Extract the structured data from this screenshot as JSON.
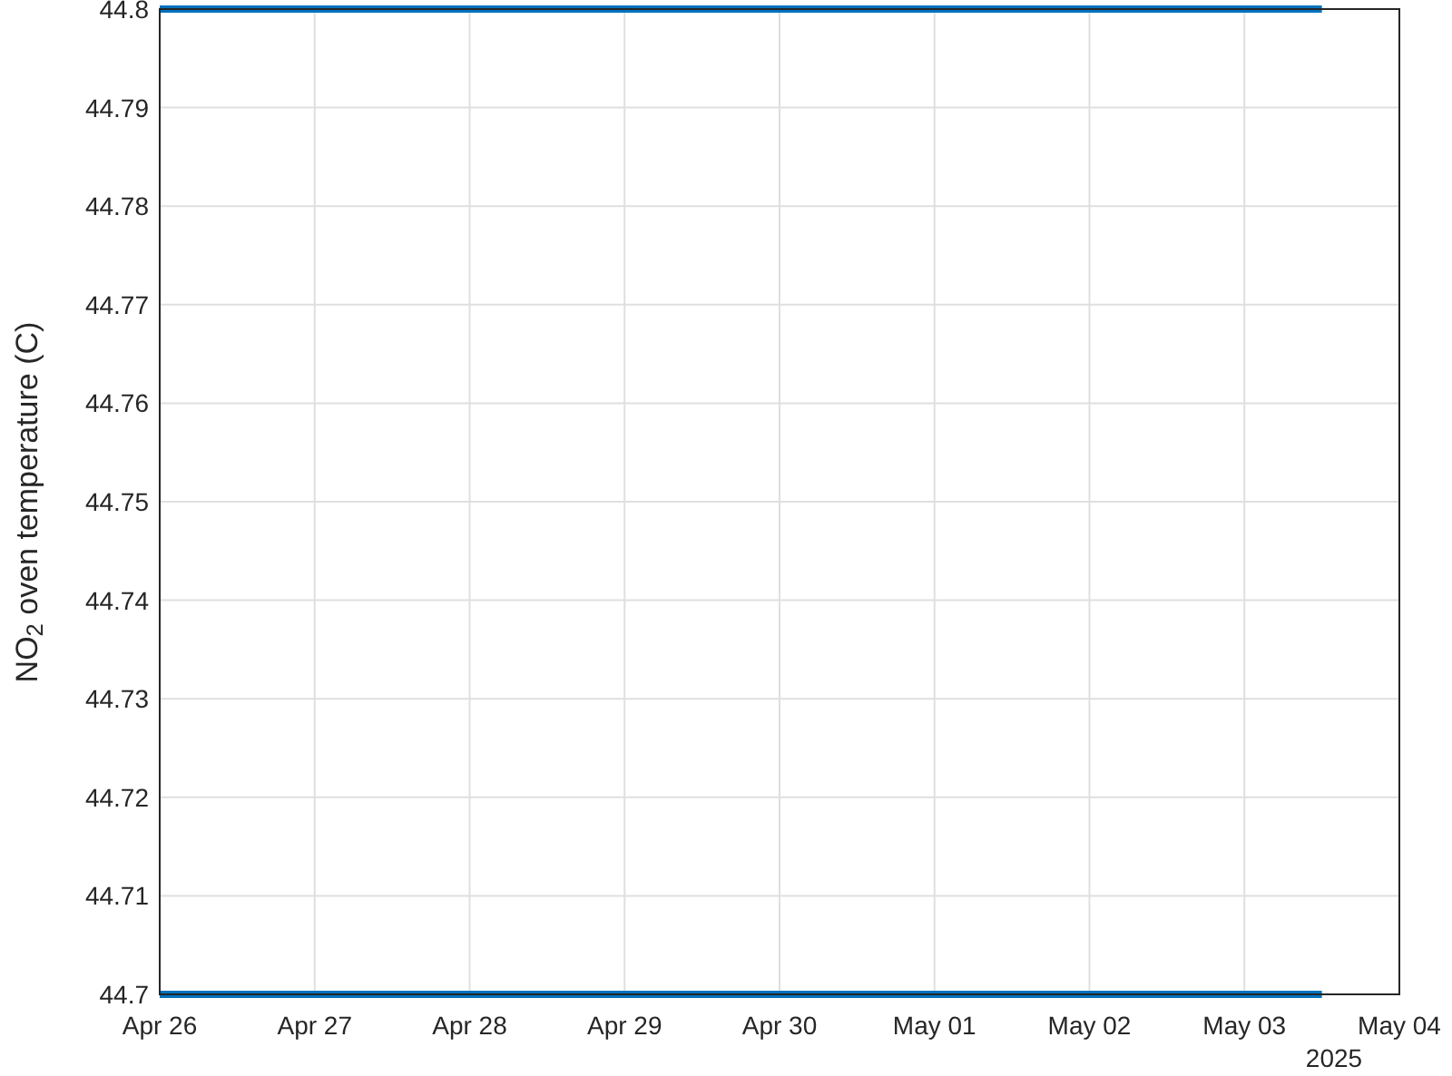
{
  "chart_data": {
    "type": "line",
    "grid": true,
    "ylabel": "NO$_{2}$ oven temperature (C)",
    "categories": [
      "Apr 26",
      null,
      "Apr 27",
      null,
      "Apr 28",
      null,
      "Apr 29",
      null,
      "Apr 30",
      null,
      "May 01",
      null,
      "May 02",
      null,
      "May 03",
      null,
      "May 04"
    ],
    "series": [
      {
        "color": "#0072bd",
        "values": [
          44.8,
          44.8,
          44.8,
          44.8,
          44.8,
          44.8,
          44.8,
          44.8,
          44.8,
          44.8,
          44.8,
          44.8,
          44.8,
          44.8,
          44.8,
          44.8,
          null
        ]
      },
      {
        "color": "#0072bd",
        "values": [
          44.7,
          44.7,
          44.7,
          44.7,
          44.7,
          44.7,
          44.7,
          44.7,
          44.7,
          44.7,
          44.7,
          44.7,
          44.7,
          44.7,
          44.7,
          44.7,
          null
        ]
      }
    ],
    "ylim": [
      44.7,
      44.8
    ],
    "yticks": [
      {
        "value": 44.7,
        "label": "44.7"
      },
      {
        "value": 44.71,
        "label": "44.71"
      },
      {
        "value": 44.72,
        "label": "44.72"
      },
      {
        "value": 44.73,
        "label": "44.73"
      },
      {
        "value": 44.74,
        "label": "44.74"
      },
      {
        "value": 44.75,
        "label": "44.75"
      },
      {
        "value": 44.76,
        "label": "44.76"
      },
      {
        "value": 44.77,
        "label": "44.77"
      },
      {
        "value": 44.78,
        "label": "44.78"
      },
      {
        "value": 44.79,
        "label": "44.79"
      },
      {
        "value": 44.8,
        "label": "44.8"
      }
    ],
    "annotations": [
      "2025"
    ]
  }
}
